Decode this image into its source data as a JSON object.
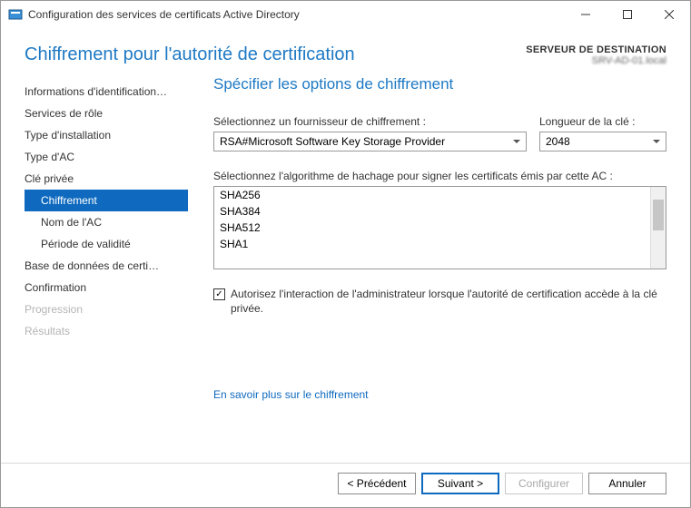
{
  "window": {
    "title": "Configuration des services de certificats Active Directory"
  },
  "header": {
    "page_title": "Chiffrement pour l'autorité de certification",
    "destination_label": "SERVEUR DE DESTINATION",
    "destination_server": "SRV-AD-01.local"
  },
  "sidebar": {
    "items": [
      {
        "label": "Informations d'identification…",
        "sub": false,
        "active": false,
        "disabled": false
      },
      {
        "label": "Services de rôle",
        "sub": false,
        "active": false,
        "disabled": false
      },
      {
        "label": "Type d'installation",
        "sub": false,
        "active": false,
        "disabled": false
      },
      {
        "label": "Type d'AC",
        "sub": false,
        "active": false,
        "disabled": false
      },
      {
        "label": "Clé privée",
        "sub": false,
        "active": false,
        "disabled": false
      },
      {
        "label": "Chiffrement",
        "sub": true,
        "active": true,
        "disabled": false
      },
      {
        "label": "Nom de l'AC",
        "sub": true,
        "active": false,
        "disabled": false
      },
      {
        "label": "Période de validité",
        "sub": true,
        "active": false,
        "disabled": false
      },
      {
        "label": "Base de données de certi…",
        "sub": false,
        "active": false,
        "disabled": false
      },
      {
        "label": "Confirmation",
        "sub": false,
        "active": false,
        "disabled": false
      },
      {
        "label": "Progression",
        "sub": false,
        "active": false,
        "disabled": true
      },
      {
        "label": "Résultats",
        "sub": false,
        "active": false,
        "disabled": true
      }
    ]
  },
  "content": {
    "title": "Spécifier les options de chiffrement",
    "provider_label": "Sélectionnez un fournisseur de chiffrement :",
    "provider_value": "RSA#Microsoft Software Key Storage Provider",
    "keylen_label": "Longueur de la clé :",
    "keylen_value": "2048",
    "hash_label": "Sélectionnez l'algorithme de hachage pour signer les certificats émis par cette AC :",
    "hash_items": [
      "SHA256",
      "SHA384",
      "SHA512",
      "SHA1"
    ],
    "checkbox_checked": true,
    "checkbox_label": "Autorisez l'interaction de l'administrateur lorsque l'autorité de certification accède à la clé privée.",
    "help_link": "En savoir plus sur le chiffrement"
  },
  "footer": {
    "prev": "< Précédent",
    "next": "Suivant >",
    "configure": "Configurer",
    "cancel": "Annuler"
  }
}
